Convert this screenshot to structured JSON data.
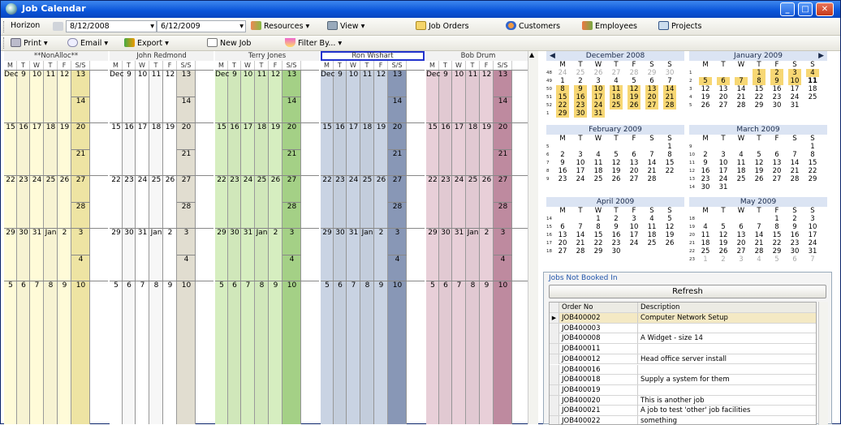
{
  "window": {
    "title": "Job Calendar"
  },
  "toolbar1": {
    "horizon_label": "Horizon",
    "start_date": "8/12/2008",
    "end_date": "6/12/2009",
    "resources": "Resources ▾",
    "view": "View ▾",
    "job_orders": "Job Orders",
    "customers": "Customers",
    "employees": "Employees",
    "projects": "Projects"
  },
  "toolbar2": {
    "print": "Print ▾",
    "email": "Email ▾",
    "export": "Export ▾",
    "new_job": "New Job",
    "filter": "Filter By... ▾"
  },
  "calendar": {
    "day_headers": [
      "M",
      "T",
      "W",
      "T",
      "F",
      "S/S"
    ],
    "employees": [
      {
        "name": "**NonAlloc**",
        "color": "#fffbd8",
        "dark": "#f5eba8"
      },
      {
        "name": "John Redmond",
        "color": "#ffffff",
        "dark": "#e8e4d6"
      },
      {
        "name": "Terry Jones",
        "color": "#d6eec0",
        "dark": "#a9d68a"
      },
      {
        "name": "Ron Wishart",
        "color": "#c9d3e3",
        "dark": "#8c9cbc"
      },
      {
        "name": "Bob Drum",
        "color": "#e8cfd8",
        "dark": "#c48ea4"
      }
    ],
    "weeks": [
      [
        "Dec",
        "9",
        "10",
        "11",
        "12",
        "13",
        "14"
      ],
      [
        "15",
        "16",
        "17",
        "18",
        "19",
        "20",
        "21"
      ],
      [
        "22",
        "23",
        "24",
        "25",
        "26",
        "27",
        "28"
      ],
      [
        "29",
        "30",
        "31",
        "Jan",
        "2",
        "3",
        "4"
      ],
      [
        "5",
        "6",
        "7",
        "8",
        "9",
        "10",
        ""
      ]
    ]
  },
  "mini_calendars": [
    {
      "month": "December 2008",
      "weeks": [
        [
          "48",
          "24",
          "25",
          "26",
          "27",
          "28",
          "29",
          "30"
        ],
        [
          "49",
          "1",
          "2",
          "3",
          "4",
          "5",
          "6",
          "7"
        ],
        [
          "50",
          "8",
          "9",
          "10",
          "11",
          "12",
          "13",
          "14"
        ],
        [
          "51",
          "15",
          "16",
          "17",
          "18",
          "19",
          "20",
          "21"
        ],
        [
          "52",
          "22",
          "23",
          "24",
          "25",
          "26",
          "27",
          "28"
        ],
        [
          "1",
          "29",
          "30",
          "31",
          "",
          "",
          "",
          ""
        ]
      ]
    },
    {
      "month": "January 2009",
      "weeks": [
        [
          "1",
          "",
          "",
          "",
          "1",
          "2",
          "3",
          "4"
        ],
        [
          "2",
          "5",
          "6",
          "7",
          "8",
          "9",
          "10",
          "11"
        ],
        [
          "3",
          "12",
          "13",
          "14",
          "15",
          "16",
          "17",
          "18"
        ],
        [
          "4",
          "19",
          "20",
          "21",
          "22",
          "23",
          "24",
          "25"
        ],
        [
          "5",
          "26",
          "27",
          "28",
          "29",
          "30",
          "31",
          ""
        ]
      ]
    },
    {
      "month": "February 2009",
      "weeks": [
        [
          "5",
          "",
          "",
          "",
          "",
          "",
          "",
          "1"
        ],
        [
          "6",
          "2",
          "3",
          "4",
          "5",
          "6",
          "7",
          "8"
        ],
        [
          "7",
          "9",
          "10",
          "11",
          "12",
          "13",
          "14",
          "15"
        ],
        [
          "8",
          "16",
          "17",
          "18",
          "19",
          "20",
          "21",
          "22"
        ],
        [
          "9",
          "23",
          "24",
          "25",
          "26",
          "27",
          "28",
          ""
        ]
      ]
    },
    {
      "month": "March 2009",
      "weeks": [
        [
          "9",
          "",
          "",
          "",
          "",
          "",
          "",
          "1"
        ],
        [
          "10",
          "2",
          "3",
          "4",
          "5",
          "6",
          "7",
          "8"
        ],
        [
          "11",
          "9",
          "10",
          "11",
          "12",
          "13",
          "14",
          "15"
        ],
        [
          "12",
          "16",
          "17",
          "18",
          "19",
          "20",
          "21",
          "22"
        ],
        [
          "13",
          "23",
          "24",
          "25",
          "26",
          "27",
          "28",
          "29"
        ],
        [
          "14",
          "30",
          "31",
          "",
          "",
          "",
          "",
          ""
        ]
      ]
    },
    {
      "month": "April 2009",
      "weeks": [
        [
          "14",
          "",
          "",
          "1",
          "2",
          "3",
          "4",
          "5"
        ],
        [
          "15",
          "6",
          "7",
          "8",
          "9",
          "10",
          "11",
          "12"
        ],
        [
          "16",
          "13",
          "14",
          "15",
          "16",
          "17",
          "18",
          "19"
        ],
        [
          "17",
          "20",
          "21",
          "22",
          "23",
          "24",
          "25",
          "26"
        ],
        [
          "18",
          "27",
          "28",
          "29",
          "30",
          "",
          "",
          ""
        ]
      ]
    },
    {
      "month": "May 2009",
      "weeks": [
        [
          "18",
          "",
          "",
          "",
          "",
          "1",
          "2",
          "3"
        ],
        [
          "19",
          "4",
          "5",
          "6",
          "7",
          "8",
          "9",
          "10"
        ],
        [
          "20",
          "11",
          "12",
          "13",
          "14",
          "15",
          "16",
          "17"
        ],
        [
          "21",
          "18",
          "19",
          "20",
          "21",
          "22",
          "23",
          "24"
        ],
        [
          "22",
          "25",
          "26",
          "27",
          "28",
          "29",
          "30",
          "31"
        ],
        [
          "23",
          "1",
          "2",
          "3",
          "4",
          "5",
          "6",
          "7"
        ]
      ]
    }
  ],
  "mini_dow": [
    "M",
    "T",
    "W",
    "T",
    "F",
    "S",
    "S"
  ],
  "jobs_panel": {
    "title": "Jobs Not Booked In",
    "refresh": "Refresh",
    "col_order": "Order No",
    "col_desc": "Description",
    "rows": [
      {
        "order": "JOB400002",
        "desc": "Computer Network Setup"
      },
      {
        "order": "JOB400003",
        "desc": ""
      },
      {
        "order": "JOB400008",
        "desc": "A Widget - size 14"
      },
      {
        "order": "JOB400011",
        "desc": ""
      },
      {
        "order": "JOB400012",
        "desc": "Head office server install"
      },
      {
        "order": "JOB400016",
        "desc": ""
      },
      {
        "order": "JOB400018",
        "desc": "Supply a system for them"
      },
      {
        "order": "JOB400019",
        "desc": ""
      },
      {
        "order": "JOB400020",
        "desc": "This is another job"
      },
      {
        "order": "JOB400021",
        "desc": "A job to test 'other' job facilities"
      },
      {
        "order": "JOB400022",
        "desc": "something"
      }
    ]
  }
}
